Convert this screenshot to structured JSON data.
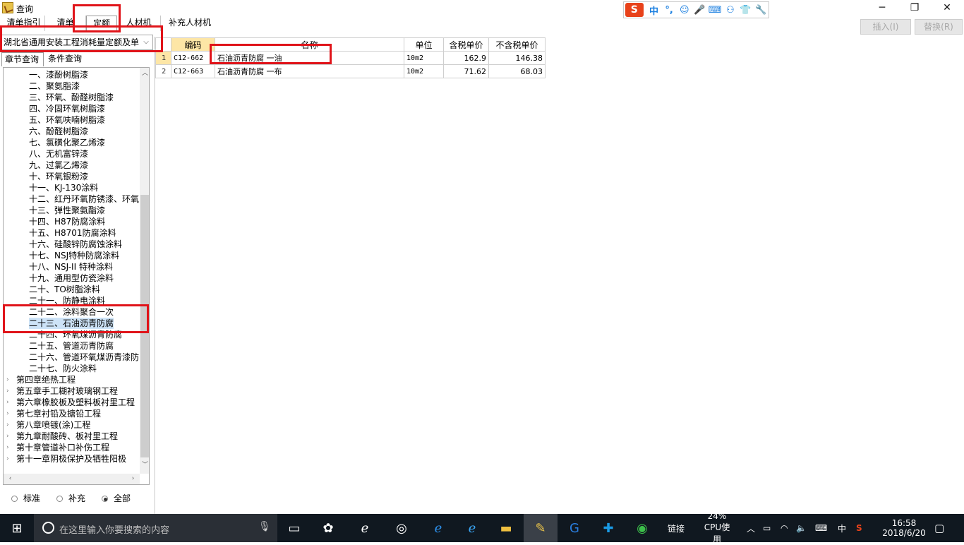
{
  "window": {
    "title": "查询",
    "minimize": "─",
    "maximize": "❐",
    "close": "✕"
  },
  "ime": {
    "logo": "S",
    "items": [
      "中",
      "°,",
      "☺",
      "🎤",
      "⌨",
      "⚇",
      "👕",
      "🔧"
    ]
  },
  "tabs": [
    {
      "label": "清单指引"
    },
    {
      "label": "清单"
    },
    {
      "label": "定额"
    },
    {
      "label": "人材机"
    },
    {
      "label": "补充人材机"
    }
  ],
  "actions": {
    "insert": "插入(I)",
    "replace": "替换(R)"
  },
  "library": {
    "selected": "湖北省通用安装工程消耗量定额及单"
  },
  "subtabs": {
    "chapter": "章节查询",
    "condition": "条件查询"
  },
  "tree": [
    {
      "label": "一、漆酚树脂漆",
      "indent": 2
    },
    {
      "label": "二、聚氨脂漆",
      "indent": 2
    },
    {
      "label": "三、环氧、酚醛树脂漆",
      "indent": 2
    },
    {
      "label": "四、冷固环氧树脂漆",
      "indent": 2
    },
    {
      "label": "五、环氧呋喃树脂漆",
      "indent": 2
    },
    {
      "label": "六、酚醛树脂漆",
      "indent": 2
    },
    {
      "label": "七、氯磺化聚乙烯漆",
      "indent": 2
    },
    {
      "label": "八、无机富锌漆",
      "indent": 2
    },
    {
      "label": "九、过氯乙烯漆",
      "indent": 2
    },
    {
      "label": "十、环氧银粉漆",
      "indent": 2
    },
    {
      "label": "十一、KJ-130涂料",
      "indent": 2
    },
    {
      "label": "十二、红丹环氧防锈漆、环氧",
      "indent": 2
    },
    {
      "label": "十三、弹性聚氨酯漆",
      "indent": 2
    },
    {
      "label": "十四、H87防腐涂料",
      "indent": 2
    },
    {
      "label": "十五、H8701防腐涂料",
      "indent": 2
    },
    {
      "label": "十六、硅酸锌防腐蚀涂料",
      "indent": 2
    },
    {
      "label": "十七、NSJ特种防腐涂料",
      "indent": 2
    },
    {
      "label": "十八、NSJ-II 特种涂料",
      "indent": 2
    },
    {
      "label": "十九、通用型仿瓷涂料",
      "indent": 2
    },
    {
      "label": "二十、TO树脂涂料",
      "indent": 2
    },
    {
      "label": "二十一、防静电涂料",
      "indent": 2
    },
    {
      "label": "二十二、涂料聚合一次",
      "indent": 2
    },
    {
      "label": "二十三、石油沥青防腐",
      "indent": 2,
      "selected": true
    },
    {
      "label": "二十四、环氧煤沥青防腐",
      "indent": 2
    },
    {
      "label": "二十五、管道沥青防腐",
      "indent": 2
    },
    {
      "label": "二十六、管道环氧煤沥青漆防",
      "indent": 2
    },
    {
      "label": "二十七、防火涂料",
      "indent": 2
    },
    {
      "label": "第四章绝热工程",
      "indent": 1,
      "arrow": "›"
    },
    {
      "label": "第五章手工糊衬玻璃钢工程",
      "indent": 1,
      "arrow": "›"
    },
    {
      "label": "第六章橡胶板及塑料板衬里工程",
      "indent": 1,
      "arrow": "›"
    },
    {
      "label": "第七章衬铅及搪铅工程",
      "indent": 1,
      "arrow": "›"
    },
    {
      "label": "第八章喷镀(涂)工程",
      "indent": 1,
      "arrow": "›"
    },
    {
      "label": "第九章耐酸砖、板衬里工程",
      "indent": 1,
      "arrow": "›"
    },
    {
      "label": "第十章管道补口补伤工程",
      "indent": 1,
      "arrow": "›"
    },
    {
      "label": "第十一章阴极保护及牺牲阳极",
      "indent": 1,
      "arrow": "›"
    }
  ],
  "filter": {
    "standard": "标准",
    "supplement": "补充",
    "all": "全部",
    "selected": "all"
  },
  "grid": {
    "headers": [
      "编码",
      "名称",
      "单位",
      "含税单价",
      "不含税单价"
    ],
    "rows": [
      {
        "no": "1",
        "code": "C12-662",
        "name": "石油沥青防腐 一油",
        "unit": "10m2",
        "price_tax": "162.9",
        "price_notax": "146.38"
      },
      {
        "no": "2",
        "code": "C12-663",
        "name": "石油沥青防腐 一布",
        "unit": "10m2",
        "price_tax": "71.62",
        "price_notax": "68.03"
      }
    ]
  },
  "taskbar": {
    "search_placeholder": "在这里输入你要搜索的内容",
    "link_label": "链接",
    "cpu_percent": "24%",
    "cpu_label": "CPU使用",
    "ime_lang": "中",
    "time": "16:58",
    "date": "2018/6/20"
  }
}
